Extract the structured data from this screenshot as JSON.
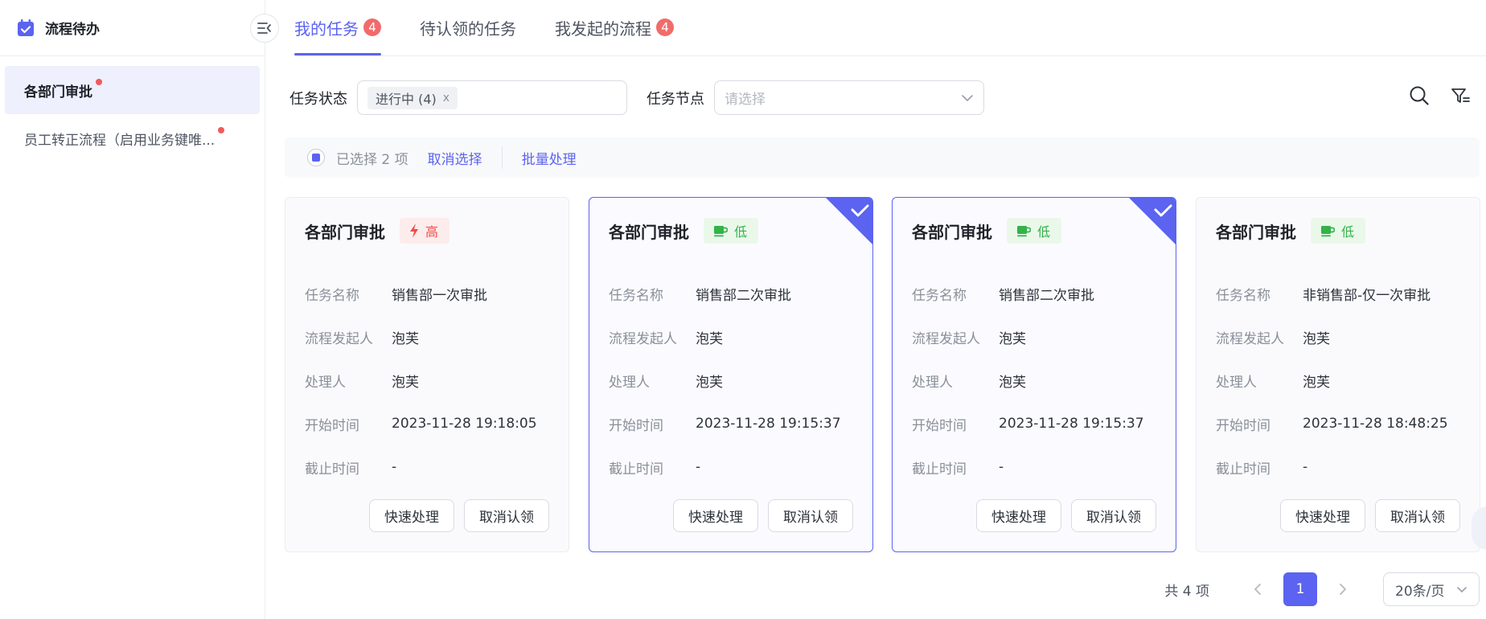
{
  "sidebar": {
    "title": "流程待办",
    "items": [
      {
        "label": "各部门审批",
        "active": true
      },
      {
        "label": "员工转正流程（启用业务键唯...",
        "active": false
      }
    ]
  },
  "tabs": [
    {
      "label": "我的任务",
      "badge": "4",
      "active": true
    },
    {
      "label": "待认领的任务",
      "badge": "",
      "active": false
    },
    {
      "label": "我发起的流程",
      "badge": "4",
      "active": false
    }
  ],
  "filters": {
    "status_label": "任务状态",
    "status_tag": "进行中 (4)",
    "status_tag_remove": "x",
    "node_label": "任务节点",
    "node_placeholder": "请选择"
  },
  "selection": {
    "text": "已选择 2 项",
    "cancel": "取消选择",
    "batch": "批量处理"
  },
  "field_labels": {
    "task_name": "任务名称",
    "initiator": "流程发起人",
    "handler": "处理人",
    "start_time": "开始时间",
    "deadline": "截止时间"
  },
  "cards": [
    {
      "title": "各部门审批",
      "priority": "高",
      "task_name": "销售部一次审批",
      "initiator": "泡芙",
      "handler": "泡芙",
      "start_time": "2023-11-28 19:18:05",
      "deadline": "-",
      "selected": false
    },
    {
      "title": "各部门审批",
      "priority": "低",
      "task_name": "销售部二次审批",
      "initiator": "泡芙",
      "handler": "泡芙",
      "start_time": "2023-11-28 19:15:37",
      "deadline": "-",
      "selected": true
    },
    {
      "title": "各部门审批",
      "priority": "低",
      "task_name": "销售部二次审批",
      "initiator": "泡芙",
      "handler": "泡芙",
      "start_time": "2023-11-28 19:15:37",
      "deadline": "-",
      "selected": true
    },
    {
      "title": "各部门审批",
      "priority": "低",
      "task_name": "非销售部-仅一次审批",
      "initiator": "泡芙",
      "handler": "泡芙",
      "start_time": "2023-11-28 18:48:25",
      "deadline": "-",
      "selected": false
    }
  ],
  "card_actions": {
    "quick": "快速处理",
    "unclaim": "取消认领"
  },
  "pagination": {
    "total": "共 4 项",
    "current": "1",
    "page_size": "20条/页"
  },
  "colors": {
    "accent": "#5b63f0",
    "badge": "#f26b6b",
    "high": "#f04a4a",
    "low": "#33b34a"
  },
  "icons": {
    "app": "calendar-check-icon",
    "collapse": "collapse-menu-icon",
    "search": "search-icon",
    "filter": "filter-list-icon",
    "high": "lightning-icon",
    "low": "cup-icon",
    "selected": "check-icon",
    "prev": "chevron-left-icon",
    "next": "chevron-right-icon",
    "dropdown": "chevron-down-icon"
  }
}
